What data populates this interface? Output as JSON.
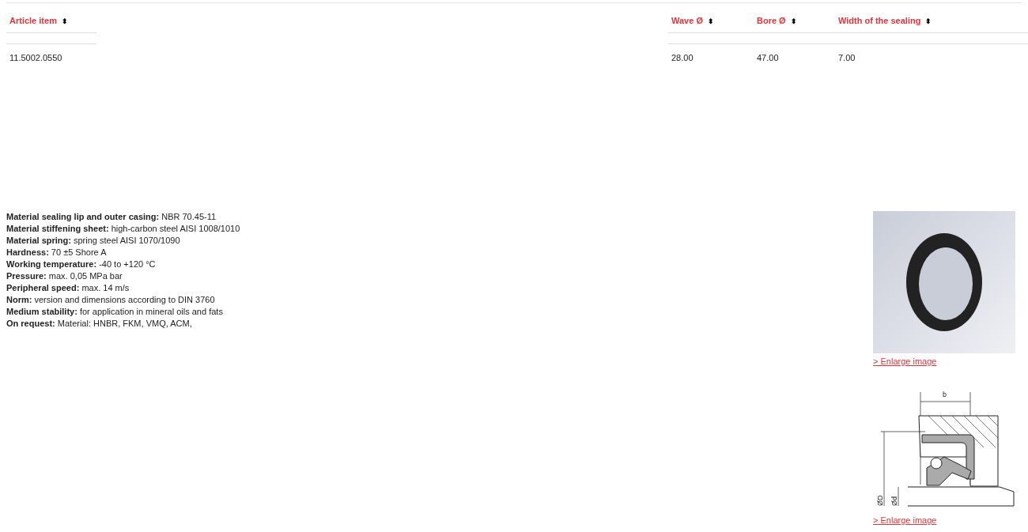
{
  "table": {
    "columns": [
      {
        "label": "Article item",
        "sort_icon": "⬍"
      },
      {
        "label": "Wave Ø",
        "sort_icon": "⬍"
      },
      {
        "label": "Bore Ø",
        "sort_icon": "⬍"
      },
      {
        "label": "Width of the sealing",
        "sort_icon": "⬍"
      }
    ],
    "rows": [
      [
        "11.5002.0550",
        "28.00",
        "47.00",
        "7.00"
      ]
    ]
  },
  "specs": [
    {
      "label": "Material sealing lip and outer casing:",
      "value": "NBR 70.45-11"
    },
    {
      "label": "Material stiffening sheet:",
      "value": "high-carbon steel AISI 1008/1010"
    },
    {
      "label": "Material spring:",
      "value": "spring steel AISI 1070/1090"
    },
    {
      "label": "Hardness:",
      "value": "70 ±5 Shore A"
    },
    {
      "label": "Working temperature:",
      "value": "-40 to +120 °C"
    },
    {
      "label": "Pressure:",
      "value": "max. 0,05 MPa bar"
    },
    {
      "label": "Peripheral speed:",
      "value": "max. 14 m/s"
    },
    {
      "label": "Norm:",
      "value": "version and dimensions according to DIN 3760"
    },
    {
      "label": "Medium stability:",
      "value": "for application in mineral oils and fats"
    },
    {
      "label": "On request:",
      "value": "Material: HNBR, FKM, VMQ, ACM,"
    }
  ],
  "images": [
    {
      "kind": "photo",
      "link": "> Enlarge image"
    },
    {
      "kind": "drawing",
      "link": "> Enlarge image",
      "labels": [
        "b",
        "ØD",
        "Ød"
      ]
    }
  ]
}
